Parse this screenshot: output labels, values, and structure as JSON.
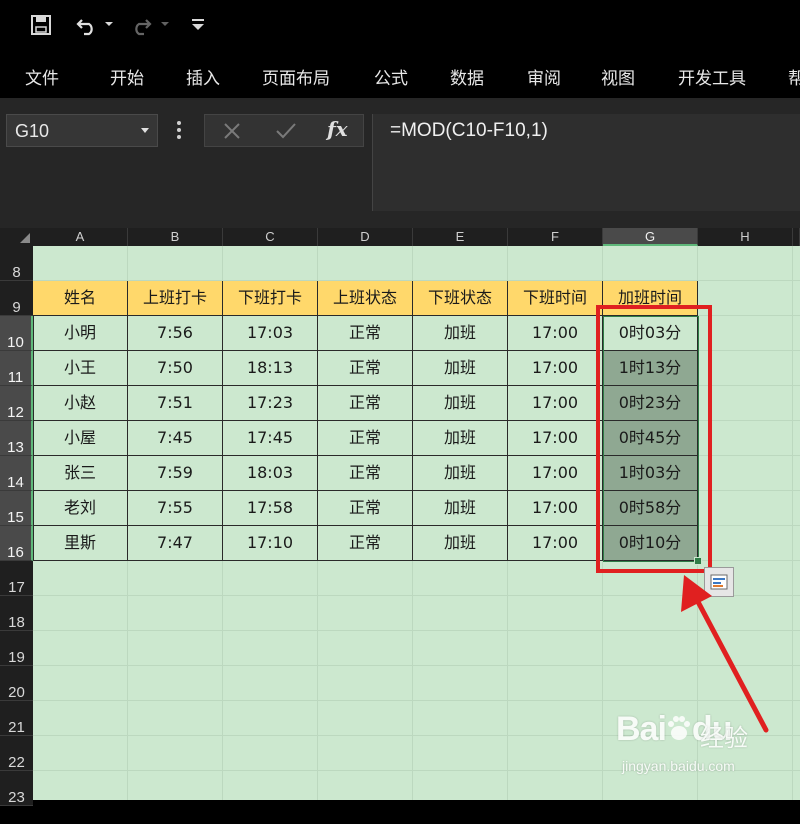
{
  "ribbon": {
    "tabs": [
      "文件",
      "开始",
      "插入",
      "页面布局",
      "公式",
      "数据",
      "审阅",
      "视图",
      "开发工具",
      "帮"
    ]
  },
  "formula_bar": {
    "name_box": "G10",
    "formula": "=MOD(C10-F10,1)",
    "fx_label": "fx"
  },
  "columns": [
    "A",
    "B",
    "C",
    "D",
    "E",
    "F",
    "G",
    "H"
  ],
  "selected_column": "G",
  "rows": [
    "8",
    "9",
    "10",
    "11",
    "12",
    "13",
    "14",
    "15",
    "16",
    "17",
    "18",
    "19",
    "20",
    "21",
    "22",
    "23"
  ],
  "table": {
    "headers": [
      "姓名",
      "上班打卡",
      "下班打卡",
      "上班状态",
      "下班状态",
      "下班时间",
      "加班时间"
    ],
    "rows": [
      [
        "小明",
        "7:56",
        "17:03",
        "正常",
        "加班",
        "17:00",
        "0时03分"
      ],
      [
        "小王",
        "7:50",
        "18:13",
        "正常",
        "加班",
        "17:00",
        "1时13分"
      ],
      [
        "小赵",
        "7:51",
        "17:23",
        "正常",
        "加班",
        "17:00",
        "0时23分"
      ],
      [
        "小屋",
        "7:45",
        "17:45",
        "正常",
        "加班",
        "17:00",
        "0时45分"
      ],
      [
        "张三",
        "7:59",
        "18:03",
        "正常",
        "加班",
        "17:00",
        "1时03分"
      ],
      [
        "老刘",
        "7:55",
        "17:58",
        "正常",
        "加班",
        "17:00",
        "0时58分"
      ],
      [
        "里斯",
        "7:47",
        "17:10",
        "正常",
        "加班",
        "17:00",
        "0时10分"
      ]
    ]
  },
  "watermark": {
    "brand": "Bai",
    "brand_suffix": "du",
    "sub": "经验",
    "url": "jingyan.baidu.com"
  },
  "colors": {
    "sheet_bg": "#cce8cf",
    "header_fill": "#ffd86b",
    "selection_fill": "#8fa892",
    "annotation_red": "#e02020"
  }
}
